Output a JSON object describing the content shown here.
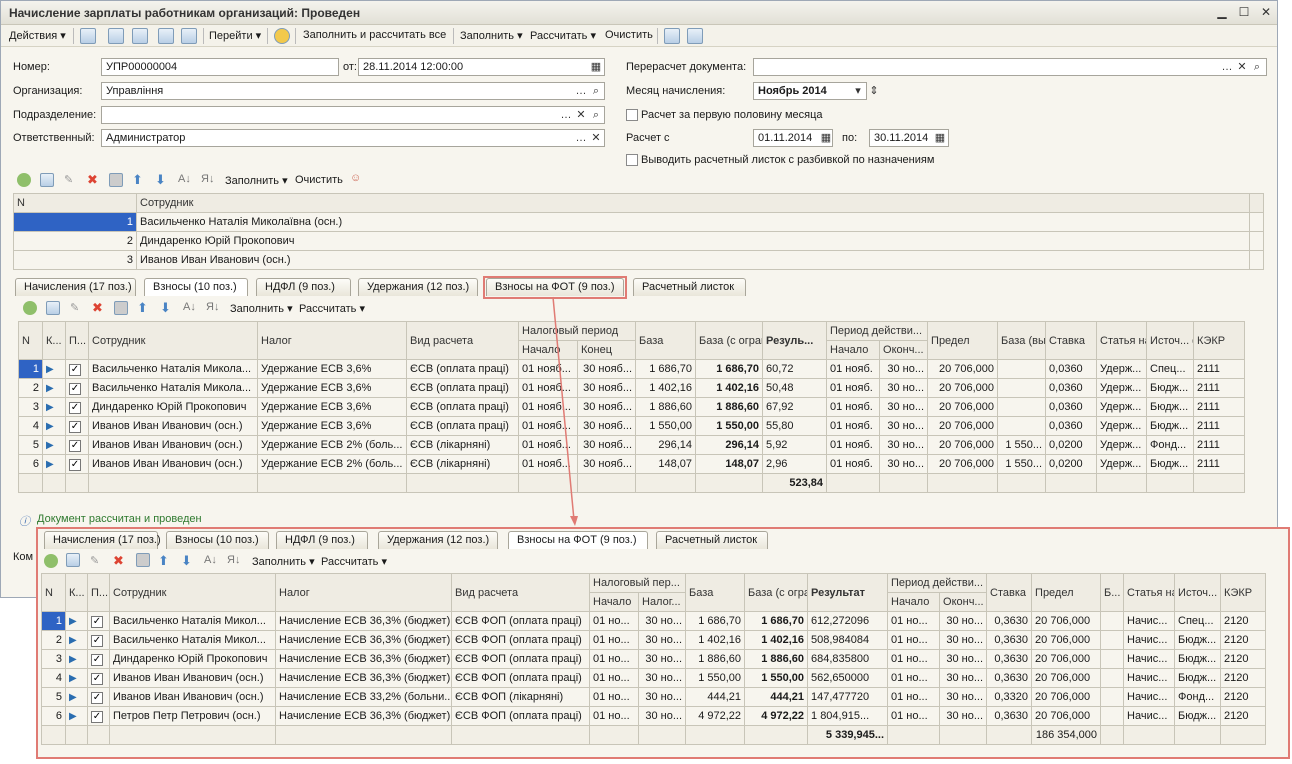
{
  "window": {
    "title": "Начисление зарплаты работникам организаций: Проведен"
  },
  "toolbar": {
    "actions": "Действия",
    "goto": "Перейти",
    "fill_calc_all": "Заполнить и рассчитать все",
    "fill": "Заполнить",
    "calculate": "Рассчитать",
    "clear": "Очистить"
  },
  "form": {
    "number_label": "Номер:",
    "number": "УПР00000004",
    "from_label": "от:",
    "date": "28.11.2014 12:00:00",
    "org_label": "Организация:",
    "org": "Управління",
    "dept_label": "Подразделение:",
    "dept": "",
    "resp_label": "Ответственный:",
    "resp": "Администратор",
    "recalc_label": "Перерасчет документа:",
    "recalc": "",
    "month_label": "Месяц начисления:",
    "month": "Ноябрь 2014",
    "first_half": "Расчет за первую половину месяца",
    "calc_from_label": "Расчет с",
    "calc_from": "01.11.2014",
    "calc_to_label": "по:",
    "calc_to": "30.11.2014",
    "payslip_split": "Выводить расчетный листок с разбивкой по назначениям"
  },
  "emp_toolbar": {
    "fill": "Заполнить",
    "clear": "Очистить"
  },
  "employees": {
    "headers": [
      "N",
      "Сотрудник"
    ],
    "rows": [
      [
        "1",
        "Васильченко Наталія Миколаївна (осн.)"
      ],
      [
        "2",
        "Диндаренко Юрій Прокопович"
      ],
      [
        "3",
        "Иванов Иван Иванович (осн.)"
      ]
    ]
  },
  "tabs": [
    "Начисления (17 поз.)",
    "Взносы (10 поз.)",
    "НДФЛ (9 поз.)",
    "Удержания (12 поз.)",
    "Взносы на ФОТ (9 поз.)",
    "Расчетный листок"
  ],
  "sub_toolbar": {
    "fill": "Заполнить",
    "calculate": "Рассчитать"
  },
  "contrib": {
    "headers": {
      "n": "N",
      "k": "К...",
      "p": "П...\nа...",
      "emp": "Сотрудник",
      "tax": "Налог",
      "kind": "Вид расчета",
      "period": "Налоговый период",
      "start": "Начало",
      "end": "Конец",
      "base": "База",
      "base_lim": "База (с ограничен...",
      "result": "Резуль...",
      "act": "Период действи...",
      "act_start": "Начало",
      "act_end": "Оконч...",
      "limit": "Предел",
      "base_ded": "База (вычет)",
      "rate": "Ставка",
      "article": "Статья налого...",
      "source": "Источ... фина...",
      "kekr": "КЭКР"
    },
    "rows": [
      [
        "1",
        "Васильченко Наталія Микола...",
        "Удержание ЕСВ 3,6%",
        "ЄСВ (оплата праці)",
        "01 нояб...",
        "30 нояб...",
        "1 686,70",
        "1 686,70",
        "60,72",
        "01 нояб.",
        "30 но...",
        "20 706,000",
        "",
        "0,0360",
        "Удерж...",
        "Спец...",
        "2111"
      ],
      [
        "2",
        "Васильченко Наталія Микола...",
        "Удержание ЕСВ 3,6%",
        "ЄСВ (оплата праці)",
        "01 нояб...",
        "30 нояб...",
        "1 402,16",
        "1 402,16",
        "50,48",
        "01 нояб.",
        "30 но...",
        "20 706,000",
        "",
        "0,0360",
        "Удерж...",
        "Бюдж...",
        "2111"
      ],
      [
        "3",
        "Диндаренко Юрій Прокопович",
        "Удержание ЕСВ 3,6%",
        "ЄСВ (оплата праці)",
        "01 нояб...",
        "30 нояб...",
        "1 886,60",
        "1 886,60",
        "67,92",
        "01 нояб.",
        "30 но...",
        "20 706,000",
        "",
        "0,0360",
        "Удерж...",
        "Бюдж...",
        "2111"
      ],
      [
        "4",
        "Иванов Иван Иванович (осн.)",
        "Удержание ЕСВ 3,6%",
        "ЄСВ (оплата праці)",
        "01 нояб...",
        "30 нояб...",
        "1 550,00",
        "1 550,00",
        "55,80",
        "01 нояб.",
        "30 но...",
        "20 706,000",
        "",
        "0,0360",
        "Удерж...",
        "Бюдж...",
        "2111"
      ],
      [
        "5",
        "Иванов Иван Иванович (осн.)",
        "Удержание ЕСВ 2% (боль...",
        "ЄСВ (лікарняні)",
        "01 нояб...",
        "30 нояб...",
        "296,14",
        "296,14",
        "5,92",
        "01 нояб.",
        "30 но...",
        "20 706,000",
        "1 550...",
        "0,0200",
        "Удерж...",
        "Фонд...",
        "2111"
      ],
      [
        "6",
        "Иванов Иван Иванович (осн.)",
        "Удержание ЕСВ 2% (боль...",
        "ЄСВ (лікарняні)",
        "01 нояб...",
        "30 нояб...",
        "148,07",
        "148,07",
        "2,96",
        "01 нояб.",
        "30 но...",
        "20 706,000",
        "1 550...",
        "0,0200",
        "Удерж...",
        "Бюдж...",
        "2111"
      ]
    ],
    "total": "523,84"
  },
  "status": "Документ рассчитан и проведен",
  "comment_label": "Ком",
  "fot": {
    "headers": {
      "n": "N",
      "k": "К...",
      "p": "П...\nа...",
      "emp": "Сотрудник",
      "tax": "Налог",
      "kind": "Вид расчета",
      "period": "Налоговый пер...",
      "start": "Начало",
      "end": "Налог...",
      "base": "База",
      "base_lim": "База (с ограниче...",
      "result": "Результат",
      "act": "Период действи...",
      "act_start": "Начало",
      "act_end": "Оконч...",
      "rate": "Ставка",
      "limit": "Предел",
      "b": "Б... (...",
      "article": "Статья налог...",
      "source": "Источ... фина...",
      "kekr": "КЭКР"
    },
    "rows": [
      [
        "1",
        "Васильченко Наталія Микол...",
        "Начисление ЕСВ 36,3% (бюджет)",
        "ЄСВ ФОП (оплата праці)",
        "01 но...",
        "30 но...",
        "1 686,70",
        "1 686,70",
        "612,272096",
        "01 но...",
        "30 но...",
        "0,3630",
        "20 706,000",
        "",
        "Начис...",
        "Спец...",
        "2120"
      ],
      [
        "2",
        "Васильченко Наталія Микол...",
        "Начисление ЕСВ 36,3% (бюджет)",
        "ЄСВ ФОП (оплата праці)",
        "01 но...",
        "30 но...",
        "1 402,16",
        "1 402,16",
        "508,984084",
        "01 но...",
        "30 но...",
        "0,3630",
        "20 706,000",
        "",
        "Начис...",
        "Бюдж...",
        "2120"
      ],
      [
        "3",
        "Диндаренко Юрій Прокопович",
        "Начисление ЕСВ 36,3% (бюджет)",
        "ЄСВ ФОП (оплата праці)",
        "01 но...",
        "30 но...",
        "1 886,60",
        "1 886,60",
        "684,835800",
        "01 но...",
        "30 но...",
        "0,3630",
        "20 706,000",
        "",
        "Начис...",
        "Бюдж...",
        "2120"
      ],
      [
        "4",
        "Иванов Иван Иванович (осн.)",
        "Начисление ЕСВ 36,3% (бюджет)",
        "ЄСВ ФОП (оплата праці)",
        "01 но...",
        "30 но...",
        "1 550,00",
        "1 550,00",
        "562,650000",
        "01 но...",
        "30 но...",
        "0,3630",
        "20 706,000",
        "",
        "Начис...",
        "Бюдж...",
        "2120"
      ],
      [
        "5",
        "Иванов Иван Иванович (осн.)",
        "Начисление ЕСВ 33,2% (больни...",
        "ЄСВ ФОП (лікарняні)",
        "01 но...",
        "30 но...",
        "444,21",
        "444,21",
        "147,477720",
        "01 но...",
        "30 но...",
        "0,3320",
        "20 706,000",
        "",
        "Начис...",
        "Фонд...",
        "2120"
      ],
      [
        "6",
        "Петров Петр Петрович (осн.)",
        "Начисление ЕСВ 36,3% (бюджет)",
        "ЄСВ ФОП (оплата праці)",
        "01 но...",
        "30 но...",
        "4 972,22",
        "4 972,22",
        "1 804,915...",
        "01 но...",
        "30 но...",
        "0,3630",
        "20 706,000",
        "",
        "Начис...",
        "Бюдж...",
        "2120"
      ]
    ],
    "total_result": "5 339,945...",
    "total_limit": "186 354,000"
  }
}
